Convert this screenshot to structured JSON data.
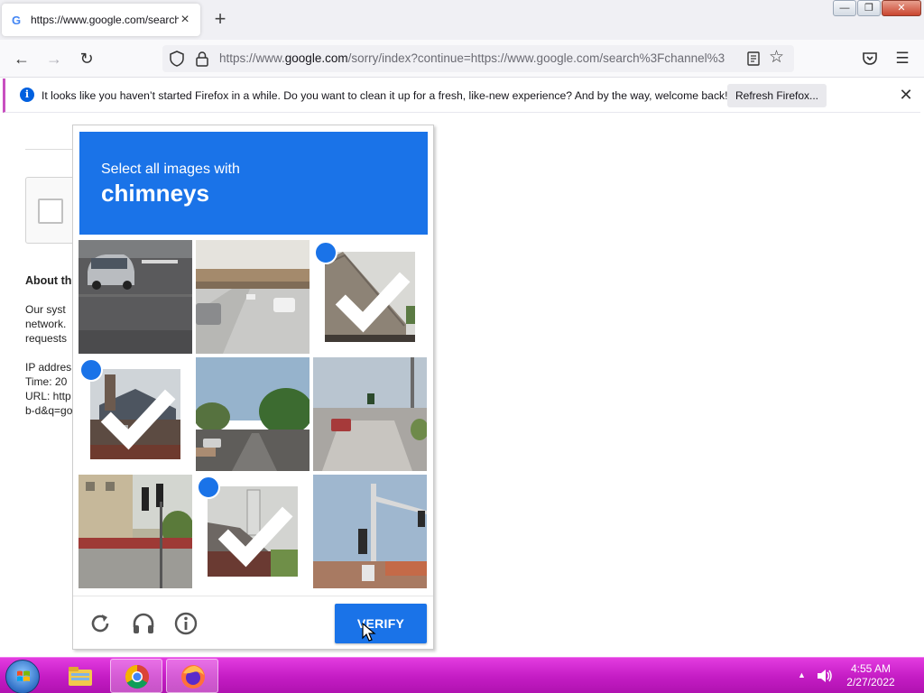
{
  "browser": {
    "tab_title": "https://www.google.com/search",
    "tab_favicon": "G",
    "new_tab_label": "+",
    "url_prefix": "https://www.",
    "url_domain": "google.com",
    "url_rest": "/sorry/index?continue=https://www.google.com/search%3Fchannel%3",
    "window_controls": {
      "minimize": "—",
      "restore": "❐",
      "close": "✕"
    },
    "icons": [
      "back-icon",
      "forward-icon",
      "reload-icon",
      "shield-icon",
      "lock-icon",
      "reader-view-icon",
      "bookmark-star-icon",
      "pocket-icon",
      "hamburger-menu-icon"
    ]
  },
  "notification": {
    "icon_label": "i",
    "text": "It looks like you haven’t started Firefox in a while. Do you want to clean it up for a fresh, like-new experience? And by the way, welcome back!",
    "button_label": "Refresh Firefox...",
    "close_label": "✕"
  },
  "page": {
    "heading": "About th",
    "para1": "Our syst",
    "para2": "network.",
    "para3": "requests",
    "ip": "IP addres",
    "time": "Time: 20",
    "url": "URL: http",
    "url2": "b-d&q=go"
  },
  "captcha": {
    "instruction": "Select all images with",
    "keyword": "chimneys",
    "tiles": [
      {
        "subject": "street-car",
        "selected": false
      },
      {
        "subject": "road-overpass",
        "selected": false
      },
      {
        "subject": "roof-with-chimney",
        "selected": true
      },
      {
        "subject": "house-with-chimney",
        "selected": true
      },
      {
        "subject": "tree-lined-street",
        "selected": false
      },
      {
        "subject": "road-intersection",
        "selected": false
      },
      {
        "subject": "traffic-lights-building",
        "selected": false
      },
      {
        "subject": "chimney-on-roof",
        "selected": true
      },
      {
        "subject": "traffic-light-pole",
        "selected": false
      }
    ],
    "verify_label": "VERIFY",
    "footer_icons": [
      "reload-icon",
      "headphones-icon",
      "info-icon"
    ],
    "accent_color": "#1a73e8"
  },
  "taskbar": {
    "time": "4:55 AM",
    "date": "2/27/2022",
    "apps": [
      "file-explorer-icon",
      "chrome-icon",
      "firefox-icon"
    ],
    "bar_color": "#c41cc4"
  }
}
